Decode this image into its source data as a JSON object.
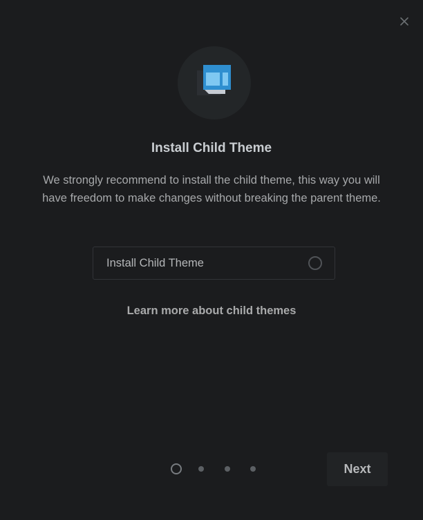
{
  "dialog": {
    "close_icon": "close-icon",
    "hero_icon": "child-theme-icon",
    "title": "Install Child Theme",
    "description": "We strongly recommend to install the child theme, this way you will have freedom to make changes without breaking the parent theme.",
    "option": {
      "label": "Install Child Theme",
      "checked": false
    },
    "learn_more_link": "Learn more about child themes",
    "pager": {
      "total_steps": 4,
      "current_step": 1
    },
    "next_label": "Next"
  },
  "colors": {
    "background": "#1b1c1e",
    "hero_circle": "#232628",
    "icon_blue": "#3a9ad9",
    "icon_light_blue": "#7cc4ee",
    "title_text": "#c9cdd1",
    "body_text": "#a7a9ab",
    "border": "#323438",
    "next_button_bg": "#212325"
  }
}
